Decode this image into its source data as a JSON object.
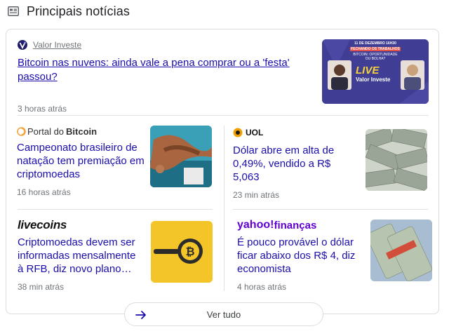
{
  "section": {
    "title": "Principais notícias"
  },
  "top_story": {
    "source": "Valor Investe",
    "headline": "Bitcoin nas nuvens: ainda vale a pena comprar ou a 'festa' passou?",
    "time": "3 horas atrás",
    "thumb_text": {
      "date": "11 DE DEZEMBRO 16H30",
      "banner": "FECHANDO OS TRABALHOS",
      "subtitle": "BITCOIN: OPORTUNIDADE OU BOLHA?",
      "live": "LIVE",
      "brand": "Valor Investe"
    }
  },
  "stories": [
    {
      "source_a": "Portal do",
      "source_b": "Bitcoin",
      "headline": "Campeonato brasileiro de natação tem premiação em criptomoedas",
      "time": "16 horas atrás"
    },
    {
      "source": "UOL",
      "headline": "Dólar abre em alta de 0,49%, vendido a R$ 5,063",
      "time": "23 min atrás"
    },
    {
      "source": "livecoins",
      "headline": "Criptomoedas devem ser informadas mensalmente à RFB, diz novo plano…",
      "time": "38 min atrás"
    },
    {
      "source_a": "yahoo!",
      "source_b": "finanças",
      "headline": "É pouco provável o dólar ficar abaixo dos R$ 4, diz economista",
      "time": "4 horas atrás"
    }
  ],
  "view_all": "Ver tudo",
  "colors": {
    "link": "#1a0dab",
    "meta": "#70757a",
    "yahoo": "#6001d2",
    "livecoins": "#111111",
    "accent": "#3b3a8f"
  }
}
